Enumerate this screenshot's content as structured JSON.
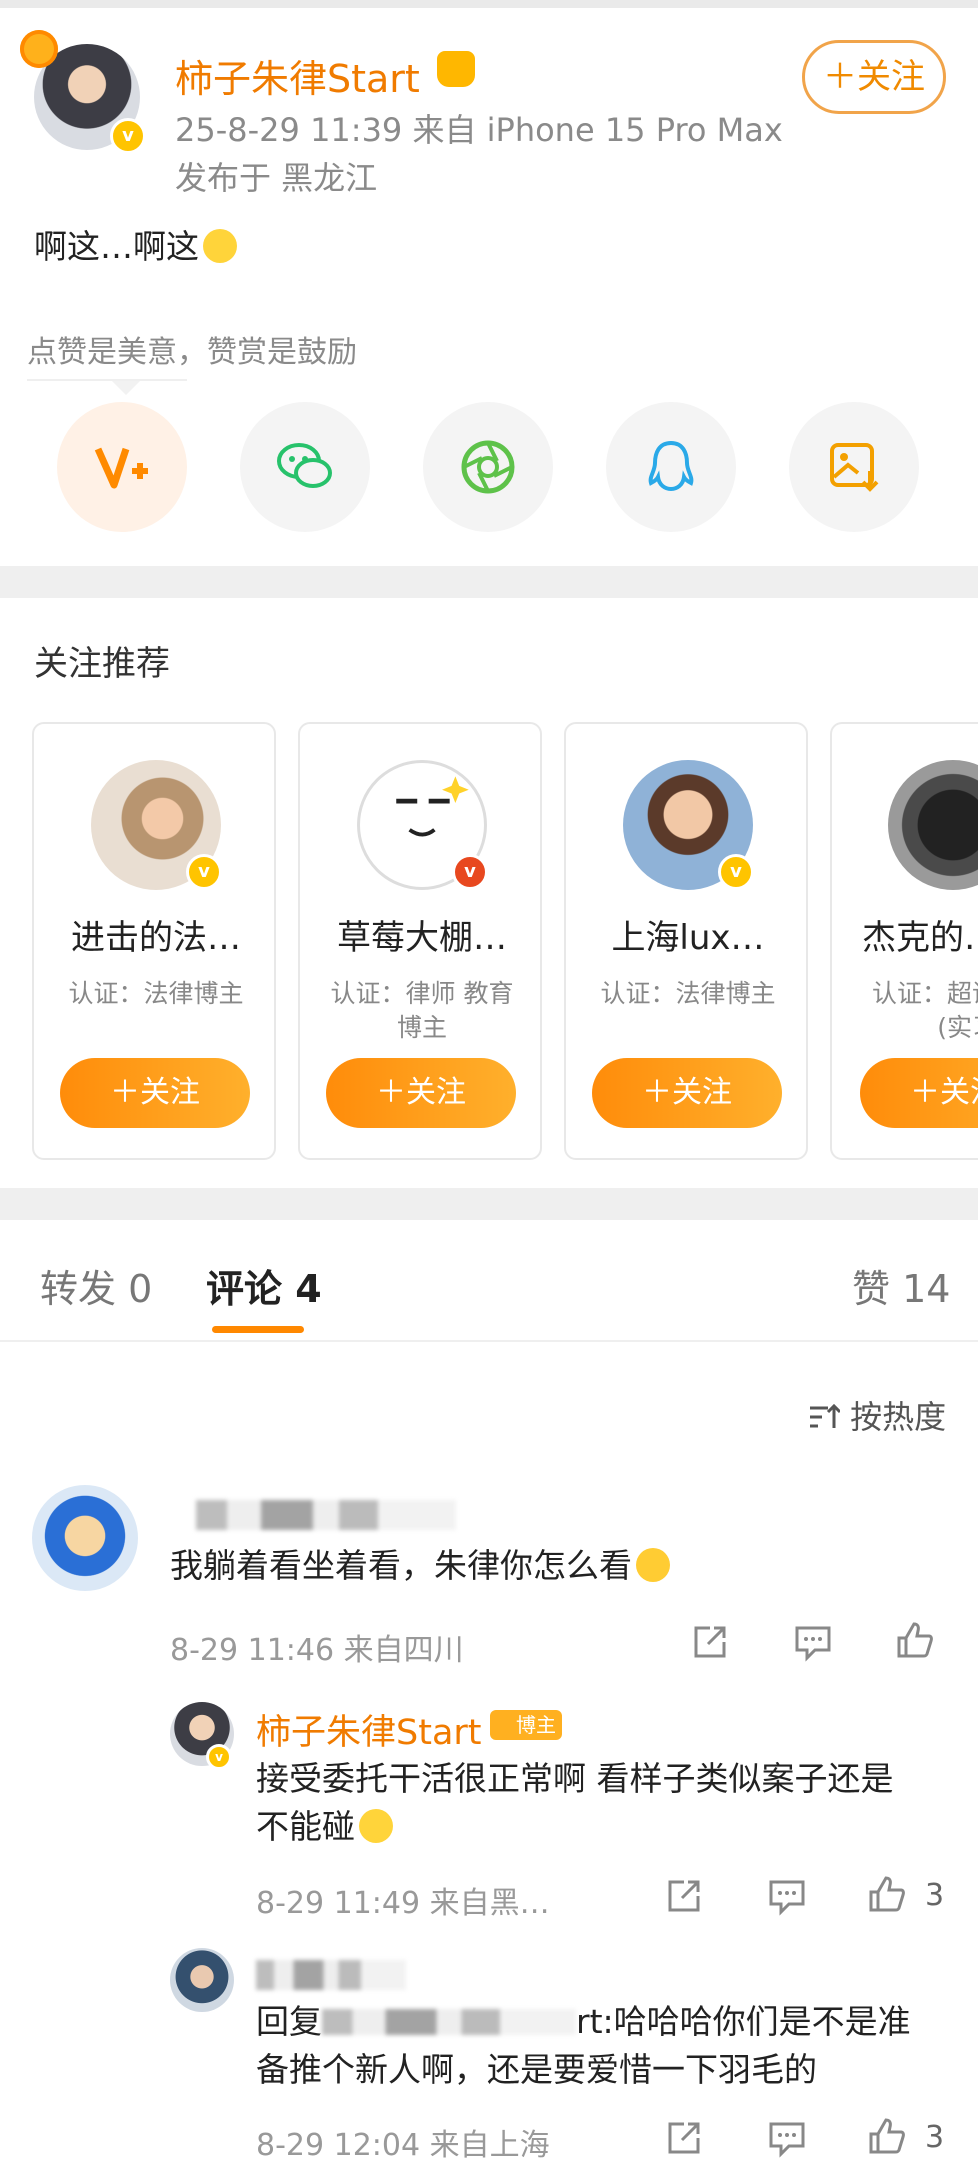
{
  "post": {
    "author": "柿子朱律Start",
    "time_source": "25-8-29 11:39  来自 iPhone 15 Pro Max",
    "location": "发布于 黑龙江",
    "follow_label": "＋关注",
    "text": "啊这…啊这",
    "reward_hint": "点赞是美意，赞赏是鼓励"
  },
  "share": [
    {
      "name": "vplus",
      "color": "#ff8a00"
    },
    {
      "name": "wechat",
      "color": "#27c26b"
    },
    {
      "name": "moments",
      "color": "#5ec24a"
    },
    {
      "name": "qq",
      "color": "#2aa9e8"
    },
    {
      "name": "save-image",
      "color": "#f3a000"
    }
  ],
  "recommend": {
    "title": "关注推荐",
    "cards": [
      {
        "name": "进击的法…",
        "desc": "认证：法律博主",
        "button": "＋关注"
      },
      {
        "name": "草莓大棚…",
        "desc": "认证：律师 教育博主",
        "button": "＋关注"
      },
      {
        "name": "上海lux…",
        "desc": "认证：法律博主",
        "button": "＋关注"
      },
      {
        "name": "杰克的…",
        "desc": "认证：超话主持人 (实习)",
        "button": "＋关注"
      }
    ]
  },
  "tabs": {
    "repost": "转发 0",
    "comments": "评论 4",
    "likes": "赞 14"
  },
  "sort_label": "按热度",
  "comments": [
    {
      "text": "我躺着看坐着看，朱律你怎么看",
      "meta": "8-29 11:46  来自四川",
      "likes": ""
    }
  ],
  "replies": [
    {
      "author": "柿子朱律Start",
      "badge": "博主",
      "text_line1": "接受委托干活很正常啊 看样子类似案子还是",
      "text_line2": "不能碰",
      "meta": "8-29 11:49  来自黑…",
      "likes": "3"
    },
    {
      "text_prefix": "回复",
      "text_tail": "rt:哈哈哈你们是不是准",
      "text_line2": "备推个新人啊，还是要爱惜一下羽毛的",
      "meta": "8-29 12:04  来自上海",
      "likes": "3"
    }
  ]
}
